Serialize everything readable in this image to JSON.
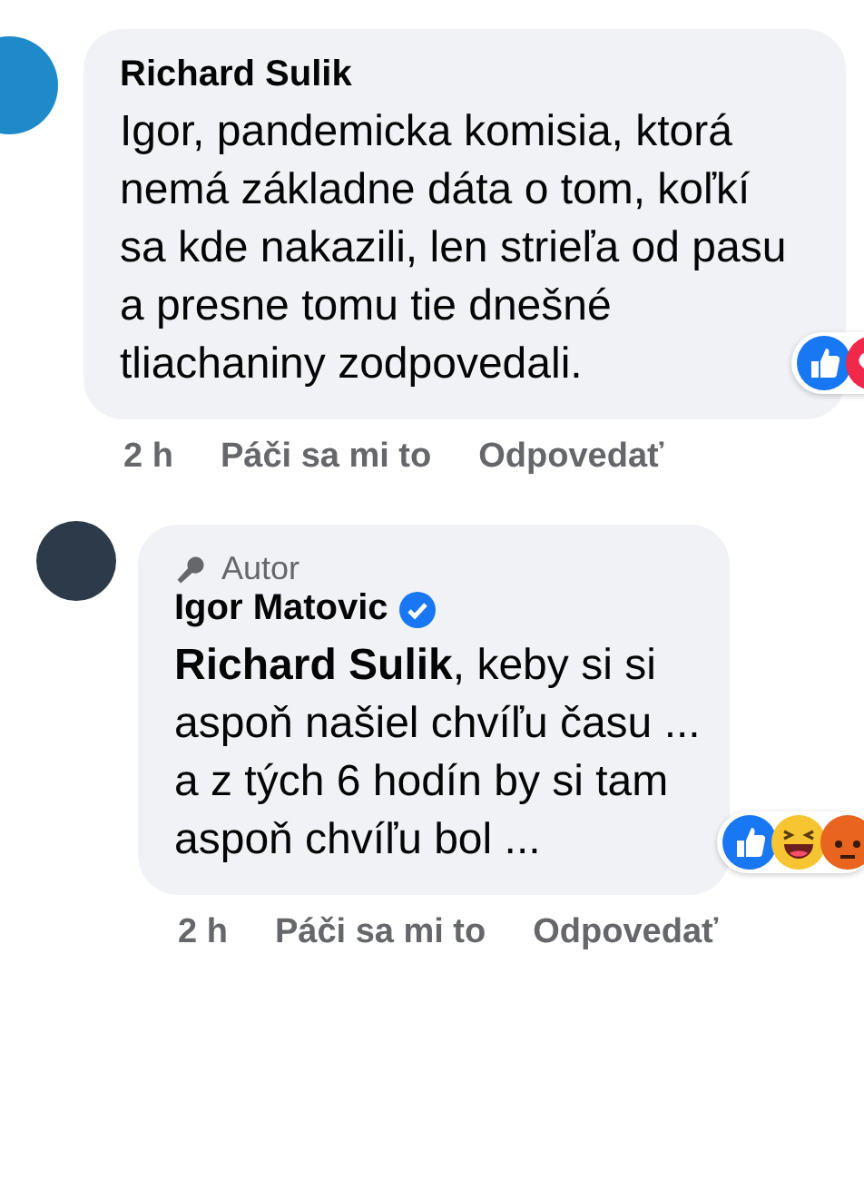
{
  "comments": [
    {
      "kind": "comment",
      "author": "Richard Sulik",
      "verified": false,
      "text": "Igor, pandemicka komisia, ktorá nemá základne dáta o tom, koľkí sa kde nakazili, len strieľa od pasu a presne tomu tie dnešné tliachaniny zodpovedali.",
      "reactions": [
        {
          "kind": "like"
        },
        {
          "kind": "love"
        }
      ],
      "time": "2 h",
      "like_action": "Páči sa mi to",
      "reply_action": "Odpovedať"
    },
    {
      "kind": "reply",
      "author_label": "Autor",
      "author": "Igor Matovic",
      "verified": true,
      "text": "**Richard Sulik**, keby si si aspoň našiel chvíľu času ... a z tých 6 hodín by si tam aspoň chvíľu bol ...",
      "reactions": [
        {
          "kind": "like"
        },
        {
          "kind": "haha"
        },
        {
          "kind": "angry"
        }
      ],
      "time": "2 h",
      "like_action": "Páči sa mi to",
      "reply_action": "Odpovedať"
    }
  ]
}
